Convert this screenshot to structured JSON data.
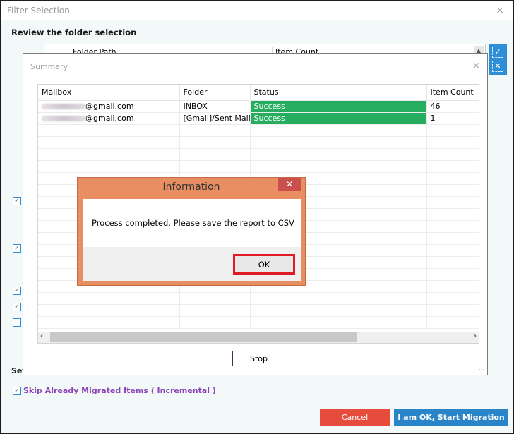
{
  "outer_window": {
    "title": "Filter Selection",
    "close_icon": "×",
    "review_label": "Review the folder selection",
    "folder_grid": {
      "columns": [
        "Folder Path",
        "Item Count"
      ]
    },
    "side_buttons": {
      "select_all_icon": "✓",
      "deselect_all_icon": "✕"
    },
    "checkboxes": [
      {
        "checked": true,
        "glyph": "✓"
      },
      {
        "checked": true,
        "glyph": "✓"
      },
      {
        "checked": true,
        "glyph": "✓"
      },
      {
        "checked": true,
        "glyph": "✓"
      },
      {
        "checked": false,
        "glyph": ""
      }
    ],
    "set_label": "Set",
    "skip_option": {
      "label": "Skip Already Migrated Items ( Incremental )",
      "checked": true,
      "glyph": "✓"
    },
    "cancel_label": "Cancel",
    "start_label": "I am OK, Start Migration"
  },
  "summary_window": {
    "title": "Summary",
    "close_icon": "×",
    "columns": [
      "Mailbox",
      "Folder",
      "Status",
      "Item Count"
    ],
    "rows": [
      {
        "mailbox_suffix": "@gmail.com",
        "folder": "INBOX",
        "status": "Success",
        "item_count": "46"
      },
      {
        "mailbox_suffix": "@gmail.com",
        "folder": "[Gmail]/Sent Mail",
        "status": "Success",
        "item_count": "1"
      }
    ],
    "scroll_left_icon": "‹",
    "scroll_right_icon": "›",
    "stop_label": "Stop",
    "status_color": "#27ad5f"
  },
  "info_dialog": {
    "title": "Information",
    "close_icon": "✕",
    "message": "Process completed. Please save the report to CSV",
    "ok_label": "OK"
  }
}
